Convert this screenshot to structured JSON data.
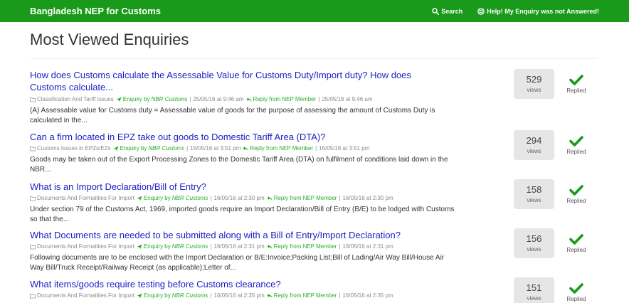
{
  "navbar": {
    "brand": "Bangladesh NEP for Customs",
    "search_label": "Search",
    "help_label": "Help! My Enquiry was not Answered!"
  },
  "page": {
    "title": "Most Viewed Enquiries"
  },
  "enquiries": [
    {
      "title": "How does Customs calculate the Assessable Value for Customs Duty/Import duty? How does Customs calculate...",
      "category": "Classification And Tariff Issues",
      "enquiry_prefix": "Enquiry by",
      "asker": "NBR Customs",
      "asked_date": "25/05/16 at 9:46 am",
      "reply_label": "Reply from NEP Member",
      "reply_date": "25/05/16 at 9:46 am",
      "excerpt": "(A) Assessable value for Customs duty = Assessable value of goods for the purpose of assessing the amount of Customs Duty is calculated in the...",
      "views": "529",
      "views_label": "views",
      "status": "Replied"
    },
    {
      "title": "Can a firm located in EPZ take out goods to Domestic Tariff Area (DTA)?",
      "category": "Customs Issues in EPZs/EZs",
      "enquiry_prefix": "Enquiry by",
      "asker": "NBR Customs",
      "asked_date": "16/05/16 at 3:51 pm",
      "reply_label": "Reply from NEP Member",
      "reply_date": "16/05/16 at 3:51 pm",
      "excerpt": "Goods may be taken out of the Export Processing Zones to the Domestic Tariff Area (DTA) on fulfilment of conditions laid down in the NBR...",
      "views": "294",
      "views_label": "views",
      "status": "Replied"
    },
    {
      "title": "What is an Import Declaration/Bill of Entry?",
      "category": "Documents And Formalities For Import",
      "enquiry_prefix": "Enquiry by",
      "asker": "NBR Customs",
      "asked_date": "16/05/16 at 2:30 pm",
      "reply_label": "Reply from NEP Member",
      "reply_date": "16/05/16 at 2:30 pm",
      "excerpt": "Under section 79 of the Customs Act, 1969, imported goods require an Import Declaration/Bill of Entry (B/E) to be lodged with Customs so that the...",
      "views": "158",
      "views_label": "views",
      "status": "Replied"
    },
    {
      "title": "What Documents are needed to be submitted along with a Bill of Entry/Import Declaration?",
      "category": "Documents And Formalities For Import",
      "enquiry_prefix": "Enquiry by",
      "asker": "NBR Customs",
      "asked_date": "16/05/16 at 2:31 pm",
      "reply_label": "Reply from NEP Member",
      "reply_date": "16/05/16 at 2:31 pm",
      "excerpt": "Following documents are to be enclosed with the Import Declaration or B/E:Invoice;Packing List;Bill of Lading/Air Way Bill/House Air Way Bill/Truck Receipt/Railway Receipt (as applicable);Letter of...",
      "views": "156",
      "views_label": "views",
      "status": "Replied"
    },
    {
      "title": "What items/goods require testing before Customs clearance?",
      "category": "Documents And Formalities For Import",
      "enquiry_prefix": "Enquiry by",
      "asker": "NBR Customs",
      "asked_date": "16/05/16 at 2:35 pm",
      "reply_label": "Reply from NEP Member",
      "reply_date": "16/05/16 at 2:35 pm",
      "excerpt": "",
      "views": "151",
      "views_label": "views",
      "status": "Replied"
    }
  ]
}
